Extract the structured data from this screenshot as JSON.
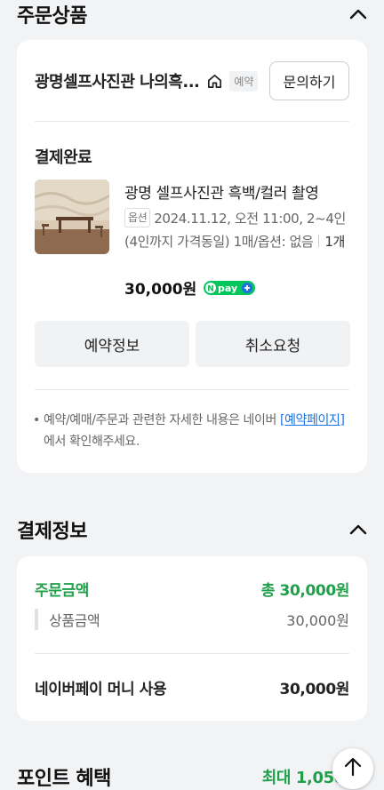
{
  "order_section": {
    "title": "주문상품",
    "store_name": "광명셀프사진관 나의흑...",
    "badge": "예약",
    "inquiry_label": "문의하기",
    "status": "결제완료",
    "product_name": "광명 셀프사진관 흑백/컬러 촬영",
    "option_badge": "옵션",
    "option_text": "2024.11.12, 오전 11:00, 2~4인(4인까지 가격동일) 1매/옵션: 없음",
    "qty": "1개",
    "price": "30,000원",
    "npay_label": "pay",
    "btn_reservation": "예약정보",
    "btn_cancel": "취소요청",
    "notice_prefix": "예약/예매/주문과 관련한 자세한 내용은 네이버 ",
    "notice_link": "[예약페이지]",
    "notice_suffix": "에서 확인해주세요."
  },
  "payment_section": {
    "title": "결제정보",
    "order_amount_label": "주문금액",
    "order_amount_value": "총 30,000원",
    "product_amount_label": "상품금액",
    "product_amount_value": "30,000원",
    "naverpay_label": "네이버페이 머니 사용",
    "naverpay_value": "30,000원"
  },
  "point_section": {
    "title": "포인트 혜택",
    "value": "최대 1,050원"
  },
  "colors": {
    "green": "#1f9f49",
    "npay_green": "#03c75a",
    "link_blue": "#1a73e8"
  },
  "icons": [
    "chevron-up-icon",
    "home-icon",
    "arrow-up-icon",
    "npay-icon"
  ]
}
